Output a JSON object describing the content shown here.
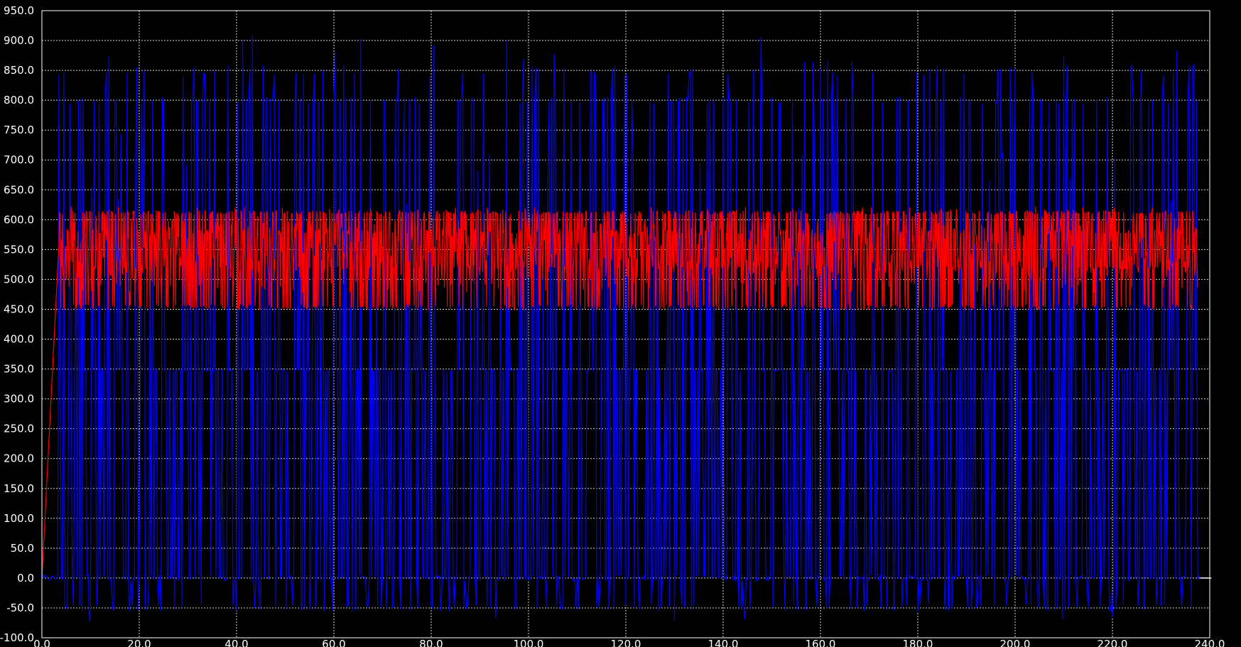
{
  "chart_data": {
    "type": "line",
    "title": "",
    "xlabel": "",
    "ylabel": "",
    "xlim": [
      0,
      240
    ],
    "ylim": [
      -100,
      950
    ],
    "grid": true,
    "background": "#000000",
    "x_ticks": [
      "0.0",
      "20.0",
      "40.0",
      "60.0",
      "80.0",
      "100.0",
      "120.0",
      "140.0",
      "160.0",
      "180.0",
      "200.0",
      "220.0",
      "240.0"
    ],
    "y_ticks": [
      "-100.0",
      "-50.0",
      "0.0",
      "50.0",
      "100.0",
      "150.0",
      "200.0",
      "250.0",
      "300.0",
      "350.0",
      "400.0",
      "450.0",
      "500.0",
      "550.0",
      "600.0",
      "650.0",
      "700.0",
      "750.0",
      "800.0",
      "850.0",
      "900.0",
      "950.0"
    ],
    "series": [
      {
        "color": "#0000ff",
        "x_range": [
          0,
          238
        ],
        "sample_interval": 0.25,
        "baseline": 0,
        "common_peak_levels": [
          350,
          800,
          850
        ],
        "max": 915,
        "min": -75,
        "typical_negative": -50
      },
      {
        "color": "#ff0000",
        "x_range": [
          0,
          237.5
        ],
        "ramp": [
          [
            0,
            0
          ],
          [
            3.5,
            560
          ]
        ],
        "center": 550,
        "band": [
          450,
          615
        ],
        "secondary_levels": [
          520,
          580
        ],
        "max": 625,
        "min": 445
      }
    ]
  }
}
